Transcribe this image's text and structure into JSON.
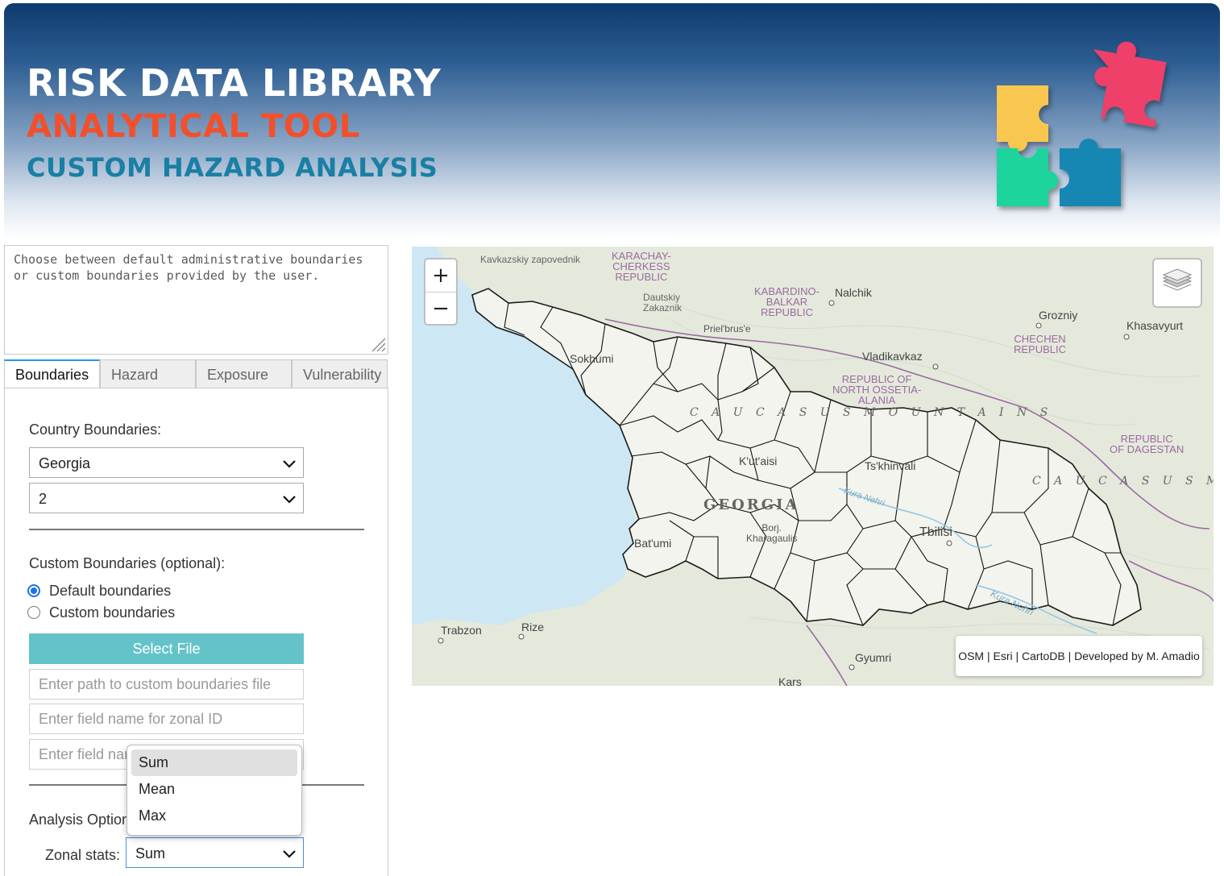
{
  "header": {
    "title_line1": "RISK DATA LIBRARY",
    "title_line2": "ANALYTICAL TOOL",
    "title_line3": "CUSTOM HAZARD ANALYSIS",
    "colors": {
      "line1": "#ffffff",
      "line2": "#f2502d",
      "line3": "#1a7fa4"
    }
  },
  "description": "Choose between default administrative boundaries or custom boundaries provided by the user.",
  "tabs": [
    {
      "label": "Boundaries",
      "active": true
    },
    {
      "label": "Hazard"
    },
    {
      "label": "Exposure"
    },
    {
      "label": "Vulnerability"
    }
  ],
  "boundaries": {
    "country_label": "Country Boundaries:",
    "country_value": "Georgia",
    "level_value": "2",
    "custom_label": "Custom Boundaries (optional):",
    "radio_default": "Default boundaries",
    "radio_custom": "Custom boundaries",
    "select_file": "Select File",
    "path_placeholder": "Enter path to custom boundaries file",
    "zonal_id_placeholder": "Enter field name for zonal ID",
    "field_name_placeholder": "Enter field name"
  },
  "analysis": {
    "label": "Analysis Options:",
    "zonal_label": "Zonal stats:",
    "zonal_value": "Sum",
    "options": [
      "Sum",
      "Mean",
      "Max"
    ]
  },
  "map": {
    "attribution": "OSM | Esri | CartoDB | Developed by M. Amadio",
    "labels": {
      "kavkazskiy": "Kavkazskiy zapovednik",
      "karachay": "KARACHAY-\nCHERKESS\nREPUBLIC",
      "kabardino": "KABARDINO-\nBALKAR\nREPUBLIC",
      "nalchik": "Nalchik",
      "grozniy": "Grozniy",
      "khasavyurt": "Khasavyurt",
      "chechen": "CHECHEN\nREPUBLIC",
      "dautskiy": "Dautskiy\nZakaznik",
      "elbrus": "Priel'brus'e",
      "sokhumi": "Sokhumi",
      "vladikavkaz": "Vladikavkaz",
      "north_ossetia": "REPUBLIC OF\nNORTH OSSETIA-\nALANIA",
      "caucasus": "C A U C A S U S   M O U N T A I N S",
      "dagestan": "REPUBLIC\nOF DAGESTAN",
      "caucasus2": "C A U C A S U S   M O U N T A",
      "kutaisi": "K'ut'aisi",
      "tskhinvali": "Ts'khinvali",
      "georgia": "GEORGIA",
      "borjomi": "Borj.\nKharagaulis",
      "tbilisi": "Tbilisi",
      "batumi": "Bat'umi",
      "trabzon": "Trabzon",
      "rize": "Rize",
      "gyumri": "Gyumri",
      "kars": "Kars",
      "kura_nehri": "Kura Nehri",
      "kura_nehri2": "Kura Nehri"
    },
    "colors": {
      "sea": "#cde7f5",
      "land": "#e4e9dc",
      "boundary": "#111111",
      "region_border": "#9b6aa0"
    }
  }
}
